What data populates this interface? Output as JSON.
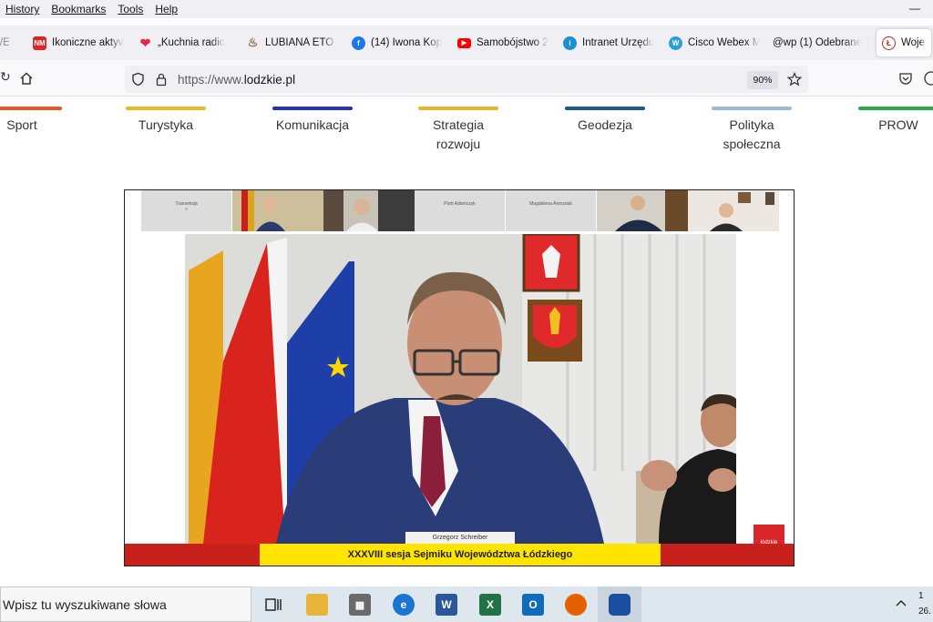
{
  "menu": [
    "History",
    "Bookmarks",
    "Tools",
    "Help"
  ],
  "window_control": "—",
  "tabs": [
    {
      "label": "/E",
      "icon": "partial-tab-icon",
      "color": "#f0f0f4"
    },
    {
      "label": "Ikoniczne aktyw",
      "icon": "nm-favicon",
      "favtext": "NM",
      "color": "#d8262b"
    },
    {
      "label": "„Kuchnia radio",
      "icon": "heart-favicon",
      "favtext": "❤",
      "color": "#e0294a"
    },
    {
      "label": "LUBIANA ETO T",
      "icon": "hat-favicon",
      "favtext": "♨",
      "color": "#8a6b4a"
    },
    {
      "label": "(14) Iwona Kop",
      "icon": "facebook-favicon",
      "favtext": "f",
      "color": "#1877f2"
    },
    {
      "label": "Samobójstwo 2",
      "icon": "youtube-favicon",
      "favtext": "▶",
      "color": "#ff0000"
    },
    {
      "label": "Intranet Urzędu",
      "icon": "intranet-favicon",
      "favtext": "i",
      "color": "#1b8fd2"
    },
    {
      "label": "Cisco Webex M",
      "icon": "webex-favicon",
      "favtext": "W",
      "color": "#2a9fd8"
    },
    {
      "label": "@wp (1) Odebrane",
      "icon": "wp-mail-favicon",
      "favtext": "",
      "color": "#f0f0f4"
    },
    {
      "label": "Wojew",
      "icon": "lodzkie-favicon",
      "favtext": "Ł",
      "color": "#c8201a"
    }
  ],
  "url": {
    "scheme": "https://www.",
    "host": "lodzkie.pl"
  },
  "zoom": "90%",
  "categories": [
    {
      "label": "Sport",
      "color": "#e8562a"
    },
    {
      "label": "Turystyka",
      "color": "#e8b92a"
    },
    {
      "label": "Komunikacja",
      "color": "#2332b8"
    },
    {
      "label": "Strategia rozwoju",
      "color": "#f0b02a"
    },
    {
      "label": "Geodezja",
      "color": "#1f5a8a"
    },
    {
      "label": "Polityka społeczna",
      "color": "#9ab8d8"
    },
    {
      "label": "PROW",
      "color": "#2aa84a"
    }
  ],
  "video": {
    "thumbnails": [
      "Transmisja",
      "",
      "",
      "Piotr Adamczyk",
      "Magdalena Amroziak",
      "",
      ""
    ],
    "speaker_name": "Grzegorz Schreiber",
    "ticker": "XXXVIII sesja Sejmiku Województwa Łódzkiego",
    "badge": "łódzkie"
  },
  "taskbar": {
    "search_placeholder": "Wpisz tu wyszukiwane słowa",
    "clock_time": "1",
    "clock_date": "26."
  }
}
